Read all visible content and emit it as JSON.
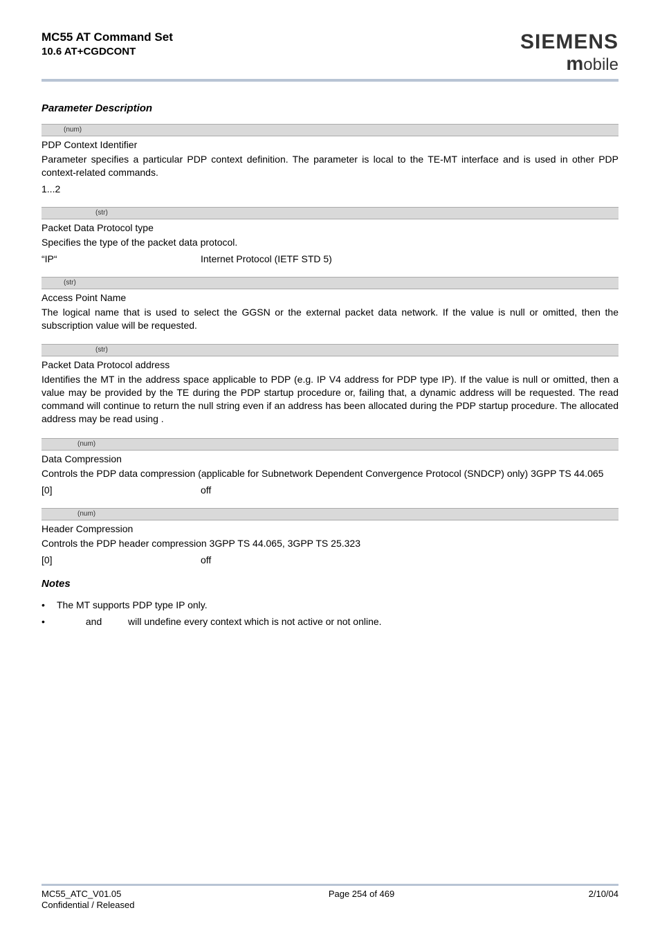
{
  "header": {
    "title_main": "MC55 AT Command Set",
    "title_sub": "10.6 AT+CGDCONT",
    "brand": "SIEMENS",
    "brand_sub": "obile"
  },
  "section1": {
    "title": "Parameter Description"
  },
  "param1": {
    "sup": "(num)",
    "title": "PDP Context Identifier",
    "body": "Parameter specifies a particular PDP context definition. The parameter is local to the TE-MT interface and is used in other PDP context-related commands.",
    "value": "1...2"
  },
  "param2": {
    "sup": "(str)",
    "title": "Packet Data Protocol type",
    "body": "Specifies the type of the packet data protocol.",
    "ip_label": "“IP“",
    "ip_desc": "Internet Protocol (IETF STD 5)"
  },
  "param3": {
    "sup": "(str)",
    "title": "Access Point Name",
    "body": "The logical name that is used to select the GGSN or the external packet data network. If the value is null or omitted, then the subscription value will be requested."
  },
  "param4": {
    "sup": "(str)",
    "title": "Packet Data Protocol address",
    "body": "Identifies the MT in the address space applicable to PDP (e.g. IP V4 address for PDP type IP). If the value is null or omitted, then a value may be provided by the TE during the PDP startup procedure or, failing that, a dynamic address will be requested. The read command will continue to return the null string even if an address has been allocated during the PDP startup procedure. The allocated address may be read using                          ."
  },
  "param5": {
    "sup": "(num)",
    "title": "Data Compression",
    "body": "Controls the PDP data compression (applicable for Subnetwork Dependent Convergence Protocol (SNDCP) only) 3GPP TS 44.065",
    "val_label": "[0]",
    "val_desc": "off"
  },
  "param6": {
    "sup": "(num)",
    "title": "Header Compression",
    "body": "Controls the PDP header compression 3GPP TS 44.065, 3GPP TS 25.323",
    "val_label": "[0]",
    "val_desc": "off"
  },
  "notes": {
    "title": "Notes",
    "item1": "The MT supports PDP type IP only.",
    "item2_a": "and",
    "item2_b": "will undefine every context which is not active or not online."
  },
  "footer": {
    "left1": "MC55_ATC_V01.05",
    "left2": "Confidential / Released",
    "center": "Page 254 of 469",
    "right": "2/10/04"
  }
}
